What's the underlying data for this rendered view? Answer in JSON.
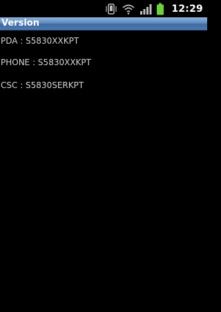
{
  "status_bar": {
    "time": "12:29",
    "icons": [
      "vibrate-icon",
      "wifi-icon",
      "signal-icon",
      "battery-icon"
    ],
    "battery_color": "#6fd23a"
  },
  "title_bar": {
    "title": "Version",
    "background_color": "#4f79b0"
  },
  "versions": {
    "pda": "PDA : S5830XXKPT",
    "phone": "PHONE : S5830XXKPT",
    "csc": "CSC : S5830SERKPT"
  },
  "colors": {
    "background": "#000000",
    "text": "#d2d2d2"
  }
}
